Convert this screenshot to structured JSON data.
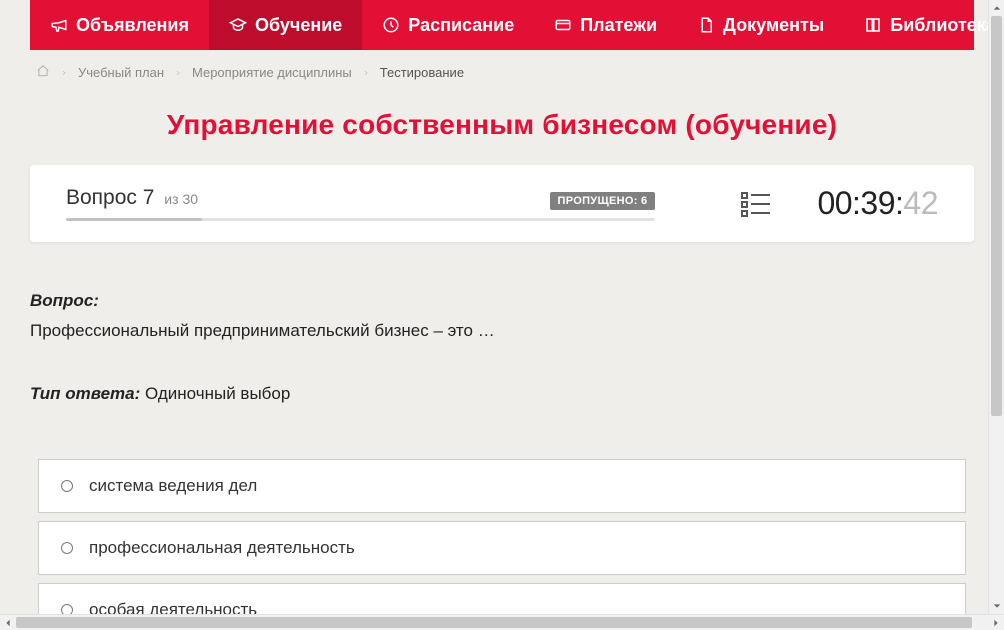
{
  "nav": {
    "items": [
      {
        "label": "Объявления",
        "icon": "megaphone"
      },
      {
        "label": "Обучение",
        "icon": "graduation",
        "active": true
      },
      {
        "label": "Расписание",
        "icon": "clock"
      },
      {
        "label": "Платежи",
        "icon": "card"
      },
      {
        "label": "Документы",
        "icon": "document"
      },
      {
        "label": "Библиотека",
        "icon": "book",
        "dropdown": true
      }
    ]
  },
  "breadcrumbs": {
    "items": [
      {
        "label": "Учебный план",
        "current": false
      },
      {
        "label": "Мероприятие дисциплины",
        "current": false
      },
      {
        "label": "Тестирование",
        "current": true
      }
    ]
  },
  "page_title": "Управление собственным бизнесом (обучение)",
  "status": {
    "question_word": "Вопрос",
    "question_num": "7",
    "of_word": "из",
    "total": "30",
    "skipped_label": "ПРОПУЩЕНО: 6",
    "progress_pct": 23,
    "timer": {
      "hm": "00:39:",
      "sec": "42"
    }
  },
  "question": {
    "heading": "Вопрос:",
    "text": "Профессиональный предпринимательский бизнес – это …",
    "answer_type_label": "Тип ответа:",
    "answer_type": "Одиночный выбор"
  },
  "answers": [
    {
      "text": "система ведения дел"
    },
    {
      "text": "профессиональная деятельность"
    },
    {
      "text": "особая деятельность"
    }
  ]
}
